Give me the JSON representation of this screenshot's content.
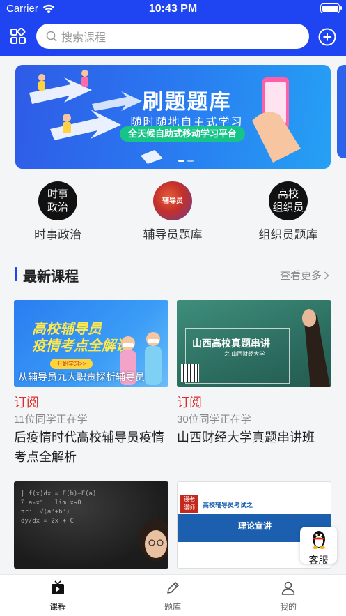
{
  "status_bar": {
    "carrier": "Carrier",
    "time": "10:43 PM"
  },
  "header": {
    "search_placeholder": "搜索课程"
  },
  "banner": {
    "title": "刷题题库",
    "subtitle": "随时随地自主式学习",
    "tag": "全天候自助式移动学习平台",
    "page_index": 0,
    "page_count": 2
  },
  "categories": [
    {
      "label": "时事政治",
      "icon_text": "时事\n政治"
    },
    {
      "label": "辅导员题库",
      "icon_text": "辅导员"
    },
    {
      "label": "组织员题库",
      "icon_text": "高校\n组织员"
    }
  ],
  "section": {
    "title": "最新课程",
    "more": "查看更多"
  },
  "courses": [
    {
      "price": "订阅",
      "learners": "11位同学正在学",
      "title": "后疫情时代高校辅导员疫情考点全解析",
      "thumb_headline": "高校辅导员\n疫情考点全解读",
      "thumb_button": "开始学习>>",
      "thumb_caption": "从辅导员九大职责探析辅导员"
    },
    {
      "price": "订阅",
      "learners": "30位同学正在学",
      "title": "山西财经大学真题串讲班",
      "thumb_headline": "山西高校真题串讲",
      "thumb_sub": "之  山西财经大学"
    },
    {
      "thumb_math": "∫ f(x)dx = F(b)−F(a)\nΣ aₙxⁿ   lim x→0\nπr²  √(a²+b²)\ndy/dx = 2x + C"
    },
    {
      "thumb_logo": "漫老\n漫师",
      "thumb_heading": "高校辅导员考试之",
      "thumb_band": "理论宣讲"
    }
  ],
  "floating": {
    "label": "客服"
  },
  "tabbar": [
    {
      "label": "课程",
      "active": true
    },
    {
      "label": "题库",
      "active": false
    },
    {
      "label": "我的",
      "active": false
    }
  ],
  "colors": {
    "brand": "#1f45f2",
    "price": "#e02b2b"
  }
}
